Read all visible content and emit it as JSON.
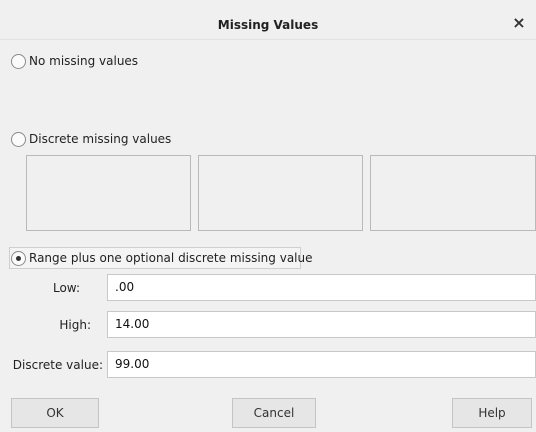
{
  "dialog": {
    "title": "Missing Values",
    "close_glyph": "×"
  },
  "options": {
    "no_missing": "No missing values",
    "discrete_missing": "Discrete missing values",
    "range_discrete": "Range plus one optional discrete missing value",
    "selected": "range_discrete"
  },
  "discrete_values": [
    "",
    "",
    ""
  ],
  "range": {
    "low_label": "Low:",
    "low_value": ".00",
    "high_label": "High:",
    "high_value": "14.00",
    "discrete_label": "Discrete value:",
    "discrete_value": "99.00"
  },
  "buttons": {
    "ok": "OK",
    "cancel": "Cancel",
    "help": "Help"
  },
  "icons": {
    "close": "close-icon"
  }
}
